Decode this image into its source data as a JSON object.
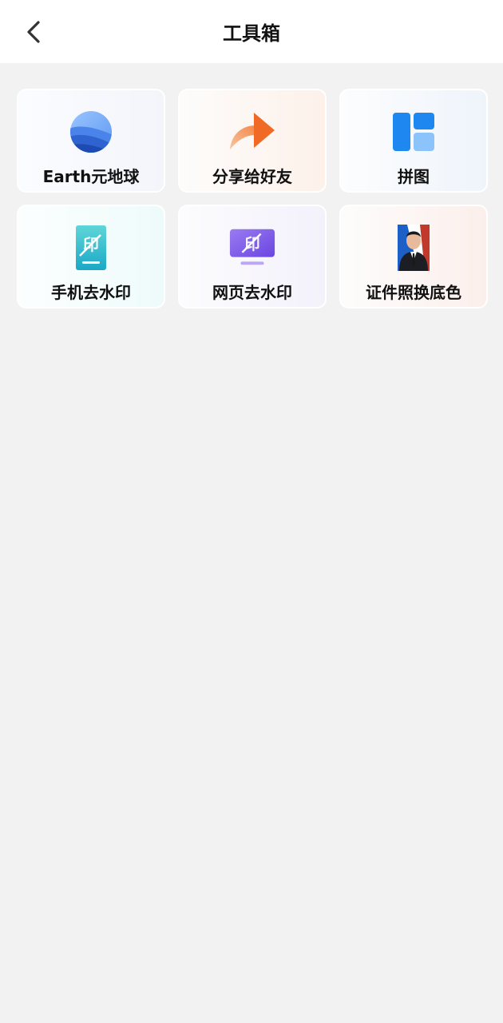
{
  "header": {
    "title": "工具箱",
    "back_icon": "chevron-left-icon"
  },
  "tools": [
    {
      "label": "Earth元地球",
      "icon": "earth-globe-icon",
      "accent": "#3b6fd8"
    },
    {
      "label": "分享给好友",
      "icon": "share-arrow-icon",
      "accent": "#f06a25"
    },
    {
      "label": "拼图",
      "icon": "collage-layout-icon",
      "accent": "#1e88f0"
    },
    {
      "label": "手机去水印",
      "icon": "phone-watermark-remove-icon",
      "accent": "#1fb6c8"
    },
    {
      "label": "网页去水印",
      "icon": "web-watermark-remove-icon",
      "accent": "#7a55e6"
    },
    {
      "label": "证件照换底色",
      "icon": "id-photo-background-icon",
      "accent": "#c0392b"
    }
  ],
  "colors": {
    "background": "#f2f2f2",
    "header_bg": "#ffffff",
    "text": "#111111"
  }
}
